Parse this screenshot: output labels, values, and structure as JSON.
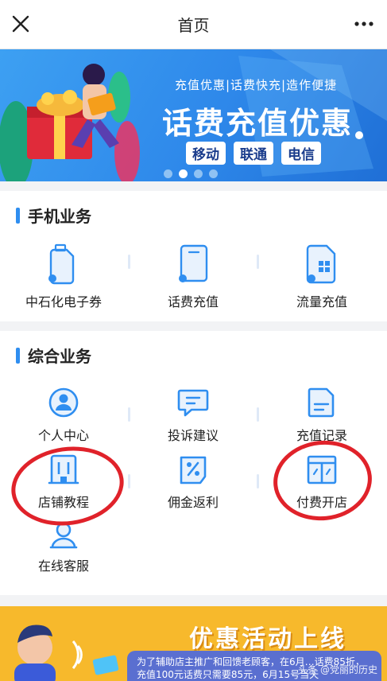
{
  "header": {
    "title": "首页",
    "close_icon": "close-icon",
    "more_icon": "more-icon"
  },
  "banner": {
    "slogan": "充值优惠|话费快充|造作便捷",
    "headline": "话费充值优惠",
    "carriers": [
      "移动",
      "联通",
      "电信"
    ],
    "slide_count": 4,
    "active_slide": 2
  },
  "mobile_section": {
    "title": "手机业务",
    "items": [
      {
        "label": "中石化电子券",
        "icon": "fuel-bottle-icon"
      },
      {
        "label": "话费充值",
        "icon": "phone-card-icon"
      },
      {
        "label": "流量充值",
        "icon": "sim-card-icon"
      }
    ]
  },
  "combined_section": {
    "title": "综合业务",
    "items": [
      {
        "label": "个人中心",
        "icon": "user-icon"
      },
      {
        "label": "投诉建议",
        "icon": "message-icon"
      },
      {
        "label": "充值记录",
        "icon": "document-icon"
      },
      {
        "label": "店铺教程",
        "icon": "building-icon"
      },
      {
        "label": "佣金返利",
        "icon": "percent-icon"
      },
      {
        "label": "付费开店",
        "icon": "storefront-icon"
      },
      {
        "label": "在线客服",
        "icon": "support-icon"
      }
    ]
  },
  "promo": {
    "title": "优惠活动上线",
    "text": "为了辅助店主推广和回馈老顾客，在6月…话费85折，充值100元话费只需要85元，6月15号当天",
    "watermark": "头条 @党丽的历史"
  },
  "colors": {
    "primary": "#2f8ef0",
    "annotation": "#e0222a",
    "promo": "#f7b92c"
  }
}
